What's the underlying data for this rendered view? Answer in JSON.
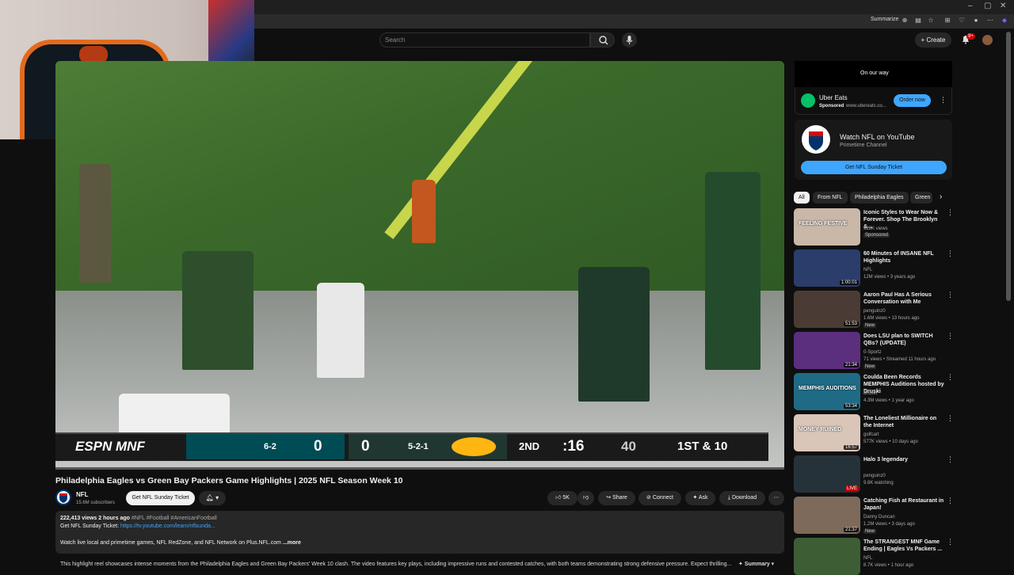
{
  "browser": {
    "window_controls": [
      "–",
      "▢",
      "✕"
    ],
    "summarize_label": "Summarize"
  },
  "header": {
    "search_placeholder": "Search",
    "create_label": "Create",
    "notification_count": "9+"
  },
  "player": {
    "scorebug": {
      "network": "ESPN MNF",
      "away_record": "6-2",
      "away_score": "0",
      "home_score": "0",
      "home_record": "5-2-1",
      "quarter": "2ND",
      "clock": ":16",
      "playclock": "40",
      "down": "1ST & 10"
    },
    "progress": 0.0
  },
  "video": {
    "title": "Philadelphia Eagles vs Green Bay Packers Game Highlights | 2025 NFL Season Week 10",
    "channel": "NFL",
    "subscribers": "15.6M subscribers",
    "sunday_ticket": "Get NFL Sunday Ticket",
    "actions": {
      "likes": "5K",
      "share": "Share",
      "connect": "Connect",
      "ask": "Ask",
      "download": "Download"
    },
    "description": {
      "stats": "222,413 views  2 hours ago",
      "tags": "#NFL #Football #AmericanFootball",
      "line2_prefix": "Get NFL Sunday Ticket: ",
      "line2_link": "https://tv.youtube.com/learn/nflsunda...",
      "line3": "Watch live local and primetime games, NFL RedZone, and NFL Network on Plus.NFL.com",
      "more": "...more",
      "summary_text": "This highlight reel showcases intense moments from the Philadelphia Eagles and Green Bay Packers' Week 10 clash. The video features key plays, including impressive runs and contested catches, with both teams demonstrating strong defensive pressure. Expect thrilling...",
      "summary_label": "Summary"
    }
  },
  "sidebar": {
    "ad": {
      "banner": "On our way",
      "advertiser": "Uber Eats",
      "sponsored": "Sponsored",
      "url": "www.ubereats.co...",
      "cta": "Order now"
    },
    "nfl_promo": {
      "title": "Watch NFL on YouTube",
      "subtitle": "Primetime Channel",
      "button": "Get NFL Sunday Ticket"
    },
    "chips": [
      "All",
      "From NFL",
      "Philadelphia Eagles",
      "Green"
    ],
    "related": [
      {
        "title": "Iconic Styles to Wear Now & Forever. Shop The Brooklyn &...",
        "meta1": "922K views",
        "meta2": "",
        "badge": "Sponsored",
        "duration": "",
        "thumb_text": "FEELING FESTIVE",
        "color": "#c9b7a8"
      },
      {
        "title": "60 Minutes of INSANE NFL Highlights",
        "meta1": "NFL",
        "meta2": "12M views • 3 years ago",
        "badge": "",
        "duration": "1:00:01",
        "thumb_text": "",
        "color": "#2b3d6b"
      },
      {
        "title": "Aaron Paul Has A Serious Conversation with Me",
        "meta1": "penguinz0",
        "meta2": "1.6M views • 13 hours ago",
        "badge": "New",
        "duration": "51:53",
        "thumb_text": "",
        "color": "#4a3c34"
      },
      {
        "title": "Does LSU plan to SWITCH QBs? (UPDATE)",
        "meta1": "0-Sportz",
        "meta2": "71 views • Streamed 11 hours ago",
        "badge": "New",
        "duration": "21:34",
        "thumb_text": "",
        "color": "#5b2e7e"
      },
      {
        "title": "Coulda Been Records MEMPHIS Auditions hosted by Druski",
        "meta1": "Druski",
        "meta2": "4.3M views • 1 year ago",
        "badge": "",
        "duration": "53:34",
        "thumb_text": "MEMPHIS AUDITIONS",
        "color": "#1f6b86"
      },
      {
        "title": "The Loneliest Millionaire on the Internet",
        "meta1": "golfcart",
        "meta2": "577K views • 10 days ago",
        "badge": "",
        "duration": "16:57",
        "thumb_text": "MONEY RUINED",
        "color": "#d9c6b8"
      },
      {
        "title": "Halo 3 legendary",
        "meta1": "penguinz0",
        "meta2": "9.8K watching",
        "badge": "",
        "duration": "LIVE",
        "thumb_text": "",
        "color": "#26323a"
      },
      {
        "title": "Catching Fish at Restaurant in Japan!",
        "meta1": "Danny Duncan",
        "meta2": "1.2M views • 3 days ago",
        "badge": "New",
        "duration": "21:37",
        "thumb_text": "",
        "color": "#7e6a5a"
      },
      {
        "title": "The STRANGEST MNF Game Ending | Eagles Vs Packers ...",
        "meta1": "NFL",
        "meta2": "8.7K views • 1 hour ago",
        "badge": "",
        "duration": "",
        "thumb_text": "",
        "color": "#3d5e34"
      }
    ]
  },
  "colors": {
    "accent": "#ff0000",
    "link": "#3ea6ff",
    "eagles": "#004c54",
    "packers": "#203731",
    "packers_gold": "#ffb612"
  }
}
